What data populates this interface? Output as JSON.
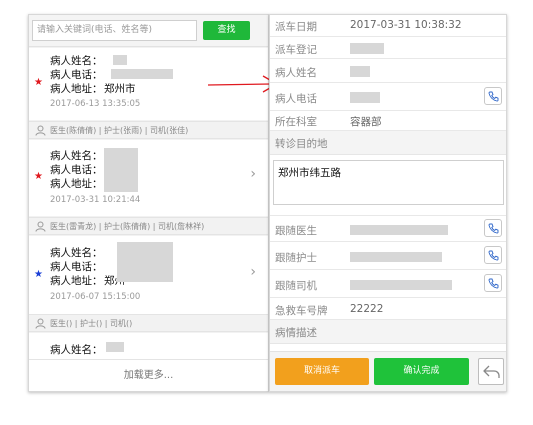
{
  "search": {
    "placeholder": "请输入关键词(电话、姓名等)",
    "button_label": "查找"
  },
  "cards": [
    {
      "name_label": "病人姓名：",
      "phone_label": "病人电话：",
      "addr_label": "病人地址：",
      "addr_value": "郑州市",
      "time": "2017-06-13 13:35:05",
      "star_color": "#e0191f"
    },
    {
      "name_label": "病人姓名：",
      "phone_label": "病人电话：",
      "addr_label": "病人地址：",
      "addr_value": "",
      "time": "2017-03-31 10:21:44",
      "star_color": "#e0191f"
    },
    {
      "name_label": "病人姓名：",
      "phone_label": "病人电话：",
      "addr_label": "病人地址：",
      "addr_value": "郑州",
      "time": "2017-06-07 15:15:00",
      "star_color": "#1a3fd6"
    },
    {
      "name_label": "病人姓名：",
      "phone_label": "",
      "addr_label": "",
      "addr_value": "",
      "time": "",
      "star_color": ""
    }
  ],
  "staff_rows": [
    {
      "text": "医生(陈倩倩)  |  护士(张雨)  |  司机(张佳)"
    },
    {
      "text": "医生(雷青龙)  |  护士(陈倩倩)  |  司机(詹林祥)"
    },
    {
      "text": "医生()  |  护士()  |  司机()"
    }
  ],
  "load_more": "加载更多...",
  "detail": {
    "dispatch_date_label": "派车日期",
    "dispatch_date_value": "2017-03-31 10:38:32",
    "dispatch_reg_label": "派车登记",
    "patient_name_label": "病人姓名",
    "patient_phone_label": "病人电话",
    "department_label": "所在科室",
    "department_value": "容器部",
    "destination_label": "转诊目的地",
    "destination_value": "郑州市纬五路",
    "doctor_label": "跟随医生",
    "nurse_label": "跟随护士",
    "driver_label": "跟随司机",
    "plate_label": "急救车号牌",
    "plate_value": "22222",
    "condition_label": "病情描述"
  },
  "actions": {
    "cancel_label": "取消派车",
    "confirm_label": "确认完成"
  },
  "colors": {
    "search_green": "#1fb83a",
    "cancel_orange": "#f2a01d",
    "confirm_green": "#1fc23a",
    "arrow_red": "#e0191f"
  }
}
